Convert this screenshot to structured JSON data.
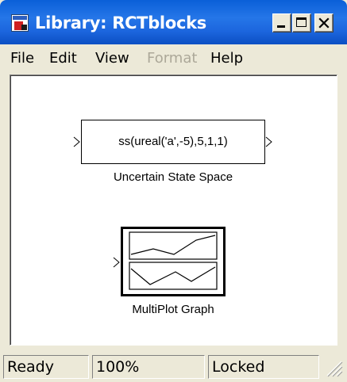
{
  "window": {
    "title": "Library: RCTblocks",
    "icon": "simulink-library-icon"
  },
  "title_buttons": {
    "minimize_icon": "minimize-icon",
    "maximize_icon": "maximize-icon",
    "close_icon": "close-icon"
  },
  "menu": {
    "items": [
      {
        "label": "File",
        "enabled": true
      },
      {
        "label": "Edit",
        "enabled": true
      },
      {
        "label": "View",
        "enabled": true
      },
      {
        "label": "Format",
        "enabled": false
      },
      {
        "label": "Help",
        "enabled": true
      }
    ]
  },
  "canvas": {
    "blocks": [
      {
        "type": "uncertain-state-space",
        "content": "ss(ureal('a',-5),5,1,1)",
        "label": "Uncertain State Space"
      },
      {
        "type": "multiplot-graph",
        "label": "MultiPlot Graph",
        "icon": "multiplot-graph-icon"
      }
    ]
  },
  "status": {
    "state": "Ready",
    "zoom": "100%",
    "lock": "Locked"
  },
  "colors": {
    "titlebar": "#0a5fd8",
    "chrome": "#ece9d8",
    "canvas": "#ffffff",
    "disabled_text": "#aca899"
  }
}
